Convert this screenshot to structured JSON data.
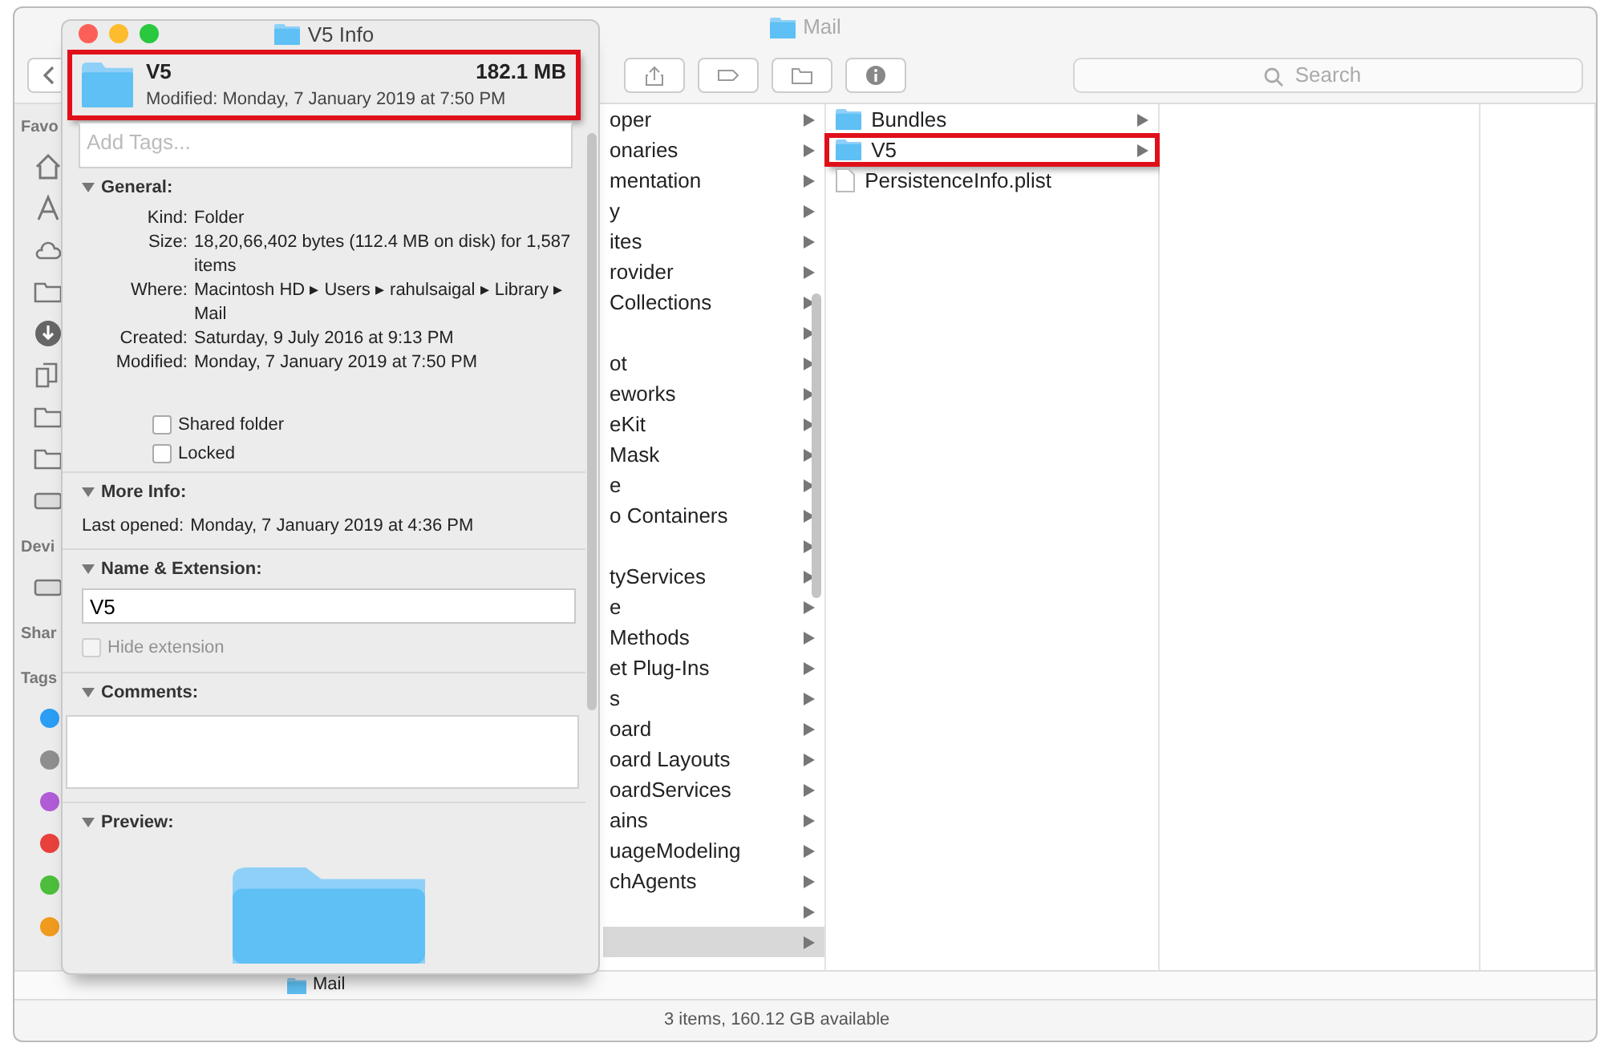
{
  "finder": {
    "title": "Mail",
    "search": {
      "placeholder": "Search"
    },
    "sidebar": {
      "sections": [
        {
          "label": "Favo"
        },
        {
          "label": "Devi"
        },
        {
          "label": "Shar"
        },
        {
          "label": "Tags",
          "tags": [
            {
              "color": "#2a9df4"
            },
            {
              "color": "#8e8e8e"
            },
            {
              "color": "#b05cd6"
            },
            {
              "color": "#e8413b"
            },
            {
              "color": "#4cbe3c"
            },
            {
              "color": "#f09a1e"
            }
          ]
        }
      ]
    },
    "columns": [
      {
        "items": [
          {
            "label": "oper",
            "selected": false
          },
          {
            "label": "onaries",
            "selected": false
          },
          {
            "label": "mentation",
            "selected": false
          },
          {
            "label": "y",
            "selected": false
          },
          {
            "label": "ites",
            "selected": false
          },
          {
            "label": "rovider",
            "selected": false
          },
          {
            "label": "Collections",
            "selected": false
          },
          {
            "selected": false
          },
          {
            "label": "ot",
            "selected": false
          },
          {
            "label": "eworks",
            "selected": false
          },
          {
            "label": "eKit",
            "selected": false
          },
          {
            "label": "Mask",
            "selected": false
          },
          {
            "label": "e",
            "selected": false
          },
          {
            "label": "o Containers",
            "selected": false
          },
          {
            "selected": false
          },
          {
            "label": "tyServices",
            "selected": false
          },
          {
            "label": "e",
            "selected": false
          },
          {
            "label": "Methods",
            "selected": false
          },
          {
            "label": "et Plug-Ins",
            "selected": false
          },
          {
            "label": "s",
            "selected": false
          },
          {
            "label": "oard",
            "selected": false
          },
          {
            "label": "oard Layouts",
            "selected": false
          },
          {
            "label": "oardServices",
            "selected": false
          },
          {
            "label": "ains",
            "selected": false
          },
          {
            "label": "uageModeling",
            "selected": false
          },
          {
            "label": "chAgents",
            "selected": false
          },
          {
            "selected": false
          },
          {
            "selected": true
          }
        ]
      },
      {
        "items": [
          {
            "label": "Bundles",
            "kind": "folder",
            "selected": false,
            "highlighted": false
          },
          {
            "label": "V5",
            "kind": "folder",
            "selected": false,
            "highlighted": true
          },
          {
            "label": "PersistenceInfo.plist",
            "kind": "file",
            "selected": false,
            "highlighted": false
          }
        ]
      }
    ],
    "path_bar": {
      "label": "Mail"
    },
    "status_bar": "3 items, 160.12 GB available"
  },
  "info": {
    "title": "V5 Info",
    "name": "V5",
    "size": "182.1 MB",
    "modified": "Modified: Monday, 7 January 2019 at 7:50 PM",
    "highlighted": true,
    "tags": {
      "placeholder": "Add Tags..."
    },
    "general": {
      "label": "General:",
      "expanded": true,
      "rows": [
        {
          "key": "Kind:",
          "value": "Folder"
        },
        {
          "key": "Size:",
          "value": "18,20,66,402 bytes (112.4 MB on disk) for 1,587 items"
        },
        {
          "key": "Where:",
          "value": "Macintosh HD ▸ Users ▸ rahulsaigal ▸ Library ▸ Mail"
        },
        {
          "key": "Created:",
          "value": "Saturday, 9 July 2016 at 9:13 PM"
        },
        {
          "key": "Modified:",
          "value": "Monday, 7 January 2019 at 7:50 PM"
        }
      ],
      "checkboxes": [
        {
          "label": "Shared folder",
          "checked": false
        },
        {
          "label": "Locked",
          "checked": false
        }
      ]
    },
    "more_info": {
      "label": "More Info:",
      "expanded": true,
      "rows": [
        {
          "key": "Last opened:",
          "value": "Monday, 7 January 2019 at 4:36 PM"
        }
      ]
    },
    "name_extension": {
      "label": "Name & Extension:",
      "expanded": true,
      "value": "V5",
      "hide_extension": {
        "label": "Hide extension",
        "checked": false,
        "disabled": true
      }
    },
    "comments": {
      "label": "Comments:",
      "expanded": true
    },
    "preview": {
      "label": "Preview:",
      "expanded": true
    }
  }
}
